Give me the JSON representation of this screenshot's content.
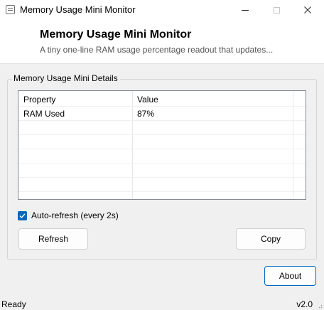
{
  "window": {
    "title": "Memory Usage Mini Monitor",
    "icon": "app-window-icon",
    "controls": [
      "minimize-icon",
      "maximize-icon",
      "close-icon"
    ]
  },
  "header": {
    "title": "Memory Usage Mini Monitor",
    "subtitle": "A tiny one-line RAM usage percentage readout that updates..."
  },
  "details": {
    "group_label": "Memory Usage Mini Details",
    "columns": [
      "Property",
      "Value"
    ],
    "rows": [
      {
        "property": "RAM Used",
        "value": "87%"
      }
    ]
  },
  "options": {
    "auto_refresh_label": "Auto-refresh (every 2s)",
    "auto_refresh_checked": true
  },
  "buttons": {
    "refresh": "Refresh",
    "copy": "Copy",
    "about": "About"
  },
  "status": {
    "left": "Ready",
    "right": "v2.0"
  },
  "colors": {
    "accent": "#0067c0"
  }
}
